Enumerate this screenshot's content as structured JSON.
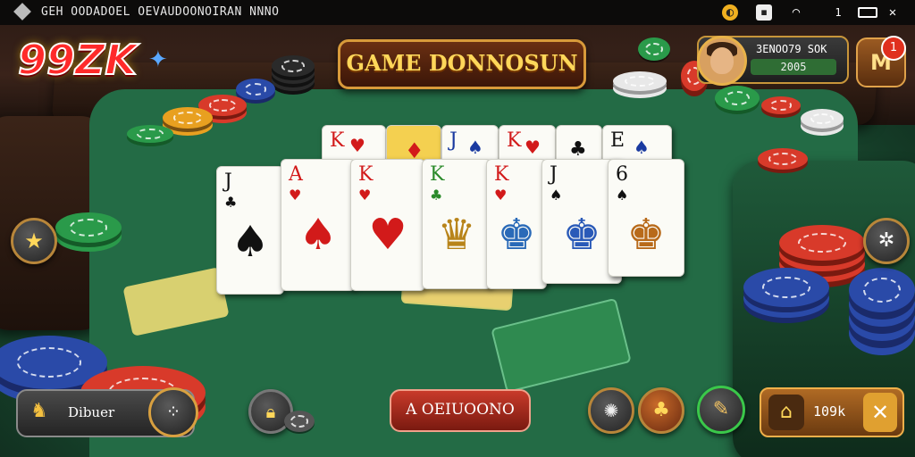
{
  "status_bar": {
    "app_title": "GEH OODADOEL  OEVAUDOONOIRAN  NNNO",
    "time": "1",
    "icons": [
      "app-logo-icon",
      "shield-icon",
      "wifi-icon",
      "battery-icon",
      "close-icon"
    ]
  },
  "header": {
    "logo_text": "99ZK",
    "banner_title": "GAME DONNOSUN",
    "profile": {
      "name": "3ENOO79 SOK",
      "level": "2005"
    },
    "menu_label": "M",
    "notification_count": "1"
  },
  "table": {
    "back_row_cards": [
      {
        "rank": "K",
        "suit": "♥",
        "color": "red"
      },
      {
        "rank": "",
        "suit": "♦",
        "color": "red"
      },
      {
        "rank": "J",
        "suit": "♠",
        "color": "black"
      },
      {
        "rank": "K",
        "suit": "♥",
        "color": "red"
      },
      {
        "rank": "",
        "suit": "♣",
        "color": "black"
      },
      {
        "rank": "E",
        "suit": "♠",
        "color": "black"
      }
    ],
    "front_row_cards": [
      {
        "rank": "J",
        "suit": "♠",
        "small": "♣",
        "color": "black"
      },
      {
        "rank": "A",
        "suit": "♠",
        "small": "♥",
        "color": "red"
      },
      {
        "rank": "K",
        "suit": "♥",
        "small": "♥",
        "color": "red"
      },
      {
        "rank": "K",
        "suit": "♛",
        "small": "♣",
        "color": "black"
      },
      {
        "rank": "K",
        "suit": "♚",
        "small": "♥",
        "color": "red"
      },
      {
        "rank": "J",
        "suit": "♚",
        "small": "♠",
        "color": "black"
      },
      {
        "rank": "6",
        "suit": "♚",
        "small": "♠",
        "color": "black"
      }
    ]
  },
  "side_buttons": {
    "left": "star-icon",
    "right": "puzzle-icon"
  },
  "bottom_bar": {
    "left_label": "Dibuer",
    "lock_button": "lock-icon",
    "action_label": "A OEIUOONO",
    "tool_buttons": [
      "gem-icon",
      "clover-icon",
      "pencil-icon"
    ],
    "balance_amount": "109k"
  },
  "colors": {
    "felt": "#236b45",
    "accent_gold": "#d89a3a",
    "action_red": "#c83a2a"
  }
}
